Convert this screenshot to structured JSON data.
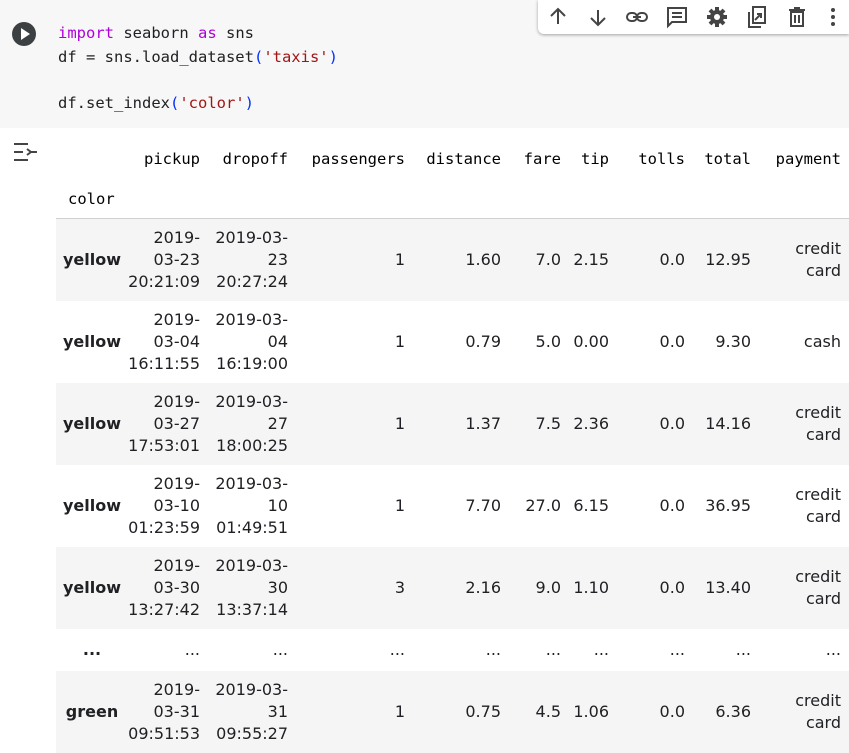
{
  "code": {
    "line1": {
      "kw1": "import",
      "mod": " seaborn ",
      "kw2": "as",
      "alias": " sns"
    },
    "line2": {
      "pre": "df = sns.load_dataset",
      "open": "(",
      "arg": "'taxis'",
      "close": ")"
    },
    "line4": {
      "pre": "df.set_index",
      "open": "(",
      "arg": "'color'",
      "close": ")"
    }
  },
  "toolbar": {
    "icons": [
      "arrow-up-icon",
      "arrow-down-icon",
      "link-icon",
      "comment-icon",
      "gear-icon",
      "mirror-cell-icon",
      "trash-icon",
      "more-vert-icon"
    ]
  },
  "dataframe": {
    "columns": [
      "pickup",
      "dropoff",
      "passengers",
      "distance",
      "fare",
      "tip",
      "tolls",
      "total",
      "payment"
    ],
    "index_name": "color",
    "rows": [
      {
        "index": "yellow",
        "pickup": "2019-03-23 20:21:09",
        "dropoff": "2019-03-23 20:27:24",
        "passengers": "1",
        "distance": "1.60",
        "fare": "7.0",
        "tip": "2.15",
        "tolls": "0.0",
        "total": "12.95",
        "payment": "credit card"
      },
      {
        "index": "yellow",
        "pickup": "2019-03-04 16:11:55",
        "dropoff": "2019-03-04 16:19:00",
        "passengers": "1",
        "distance": "0.79",
        "fare": "5.0",
        "tip": "0.00",
        "tolls": "0.0",
        "total": "9.30",
        "payment": "cash"
      },
      {
        "index": "yellow",
        "pickup": "2019-03-27 17:53:01",
        "dropoff": "2019-03-27 18:00:25",
        "passengers": "1",
        "distance": "1.37",
        "fare": "7.5",
        "tip": "2.36",
        "tolls": "0.0",
        "total": "14.16",
        "payment": "credit card"
      },
      {
        "index": "yellow",
        "pickup": "2019-03-10 01:23:59",
        "dropoff": "2019-03-10 01:49:51",
        "passengers": "1",
        "distance": "7.70",
        "fare": "27.0",
        "tip": "6.15",
        "tolls": "0.0",
        "total": "36.95",
        "payment": "credit card"
      },
      {
        "index": "yellow",
        "pickup": "2019-03-30 13:27:42",
        "dropoff": "2019-03-30 13:37:14",
        "passengers": "3",
        "distance": "2.16",
        "fare": "9.0",
        "tip": "1.10",
        "tolls": "0.0",
        "total": "13.40",
        "payment": "credit card"
      },
      {
        "index": "...",
        "pickup": "...",
        "dropoff": "...",
        "passengers": "...",
        "distance": "...",
        "fare": "...",
        "tip": "...",
        "tolls": "...",
        "total": "...",
        "payment": "..."
      },
      {
        "index": "green",
        "pickup": "2019-03-31 09:51:53",
        "dropoff": "2019-03-31 09:55:27",
        "passengers": "1",
        "distance": "0.75",
        "fare": "4.5",
        "tip": "1.06",
        "tolls": "0.0",
        "total": "6.36",
        "payment": "credit card"
      }
    ]
  }
}
